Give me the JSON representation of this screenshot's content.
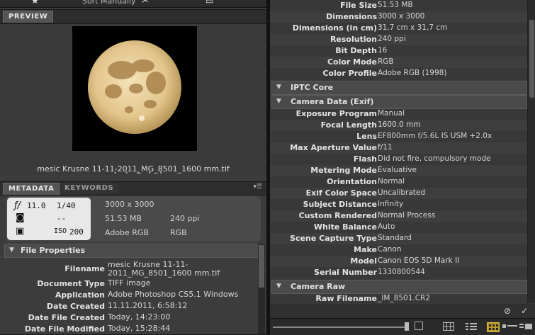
{
  "toolbar": {
    "sort_label": "Sort Manually"
  },
  "preview": {
    "tab": "PREVIEW",
    "caption": "mesic Krusne 11-11-2011_MG_8501_1600 mm.tif",
    "dots": "• • • • •"
  },
  "metadata_tabs": [
    "METADATA",
    "KEYWORDS"
  ],
  "placard": {
    "aperture": "11.0",
    "shutter": "1/40",
    "metering": "--",
    "iso": "200",
    "dimensions": "3000 x 3000",
    "size": "51.53 MB",
    "resolution": "240 ppi",
    "profile": "Adobe RGB",
    "mode": "RGB"
  },
  "file_properties": {
    "title": "File Properties",
    "rows": [
      {
        "key": "Filename",
        "value": "mesic Krusne 11-11-2011_MG_8501_1600 mm.tif"
      },
      {
        "key": "Document Type",
        "value": "TIFF image"
      },
      {
        "key": "Application",
        "value": "Adobe Photoshop CS5.1 Windows"
      },
      {
        "key": "Date Created",
        "value": "11.11.2011, 6:58:12"
      },
      {
        "key": "Date File Created",
        "value": "Today, 14:23:00"
      },
      {
        "key": "Date File Modified",
        "value": "Today, 15:28:44"
      }
    ]
  },
  "right_top_rows": [
    {
      "key": "File Size",
      "value": "51.53 MB"
    },
    {
      "key": "Dimensions",
      "value": "3000 x 3000"
    },
    {
      "key": "Dimensions (in cm)",
      "value": "31,7 cm x 31,7 cm"
    },
    {
      "key": "Resolution",
      "value": "240 ppi"
    },
    {
      "key": "Bit Depth",
      "value": "16"
    },
    {
      "key": "Color Mode",
      "value": "RGB"
    },
    {
      "key": "Color Profile",
      "value": "Adobe RGB (1998)"
    }
  ],
  "sections": {
    "iptc": "IPTC Core",
    "camera": "Camera Data (Exif)",
    "raw": "Camera Raw"
  },
  "camera_rows": [
    {
      "key": "Exposure Program",
      "value": "Manual"
    },
    {
      "key": "Focal Length",
      "value": "1600.0 mm"
    },
    {
      "key": "Lens",
      "value": "EF800mm f/5.6L IS USM +2.0x"
    },
    {
      "key": "Max Aperture Value",
      "value": "f/11"
    },
    {
      "key": "Flash",
      "value": "Did not fire, compulsory mode"
    },
    {
      "key": "Metering Mode",
      "value": "Evaluative"
    },
    {
      "key": "Orientation",
      "value": "Normal"
    },
    {
      "key": "Exif Color Space",
      "value": "Uncalibrated"
    },
    {
      "key": "Subject Distance",
      "value": "Infinity"
    },
    {
      "key": "Custom Rendered",
      "value": "Normal Process"
    },
    {
      "key": "White Balance",
      "value": "Auto"
    },
    {
      "key": "Scene Capture Type",
      "value": "Standard"
    },
    {
      "key": "Make",
      "value": "Canon"
    },
    {
      "key": "Model",
      "value": "Canon EOS 5D Mark II"
    },
    {
      "key": "Serial Number",
      "value": "1330800544"
    }
  ],
  "raw_rows": [
    {
      "key": "Raw Filename",
      "value": "_IM_8501.CR2"
    }
  ]
}
